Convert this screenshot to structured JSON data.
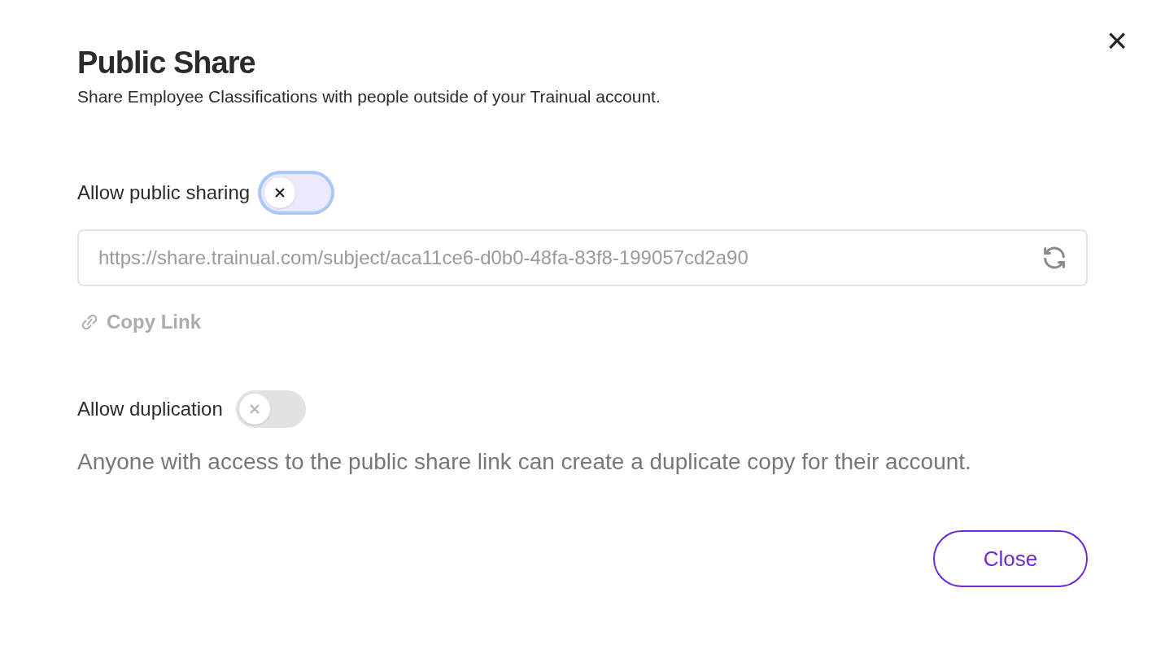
{
  "dialog": {
    "title": "Public Share",
    "subtitle": "Share Employee Classifications with people outside of your Trainual account.",
    "close_icon": "×"
  },
  "public_sharing": {
    "label": "Allow public sharing",
    "on": false,
    "focused": true
  },
  "link_field": {
    "value": "https://share.trainual.com/subject/aca11ce6-d0b0-48fa-83f8-199057cd2a90"
  },
  "copy_link": {
    "label": "Copy Link",
    "disabled": true
  },
  "duplication": {
    "label": "Allow duplication",
    "on": false,
    "focused": false,
    "disabled": true,
    "description": "Anyone with access to the public share link can create a duplicate copy for their account."
  },
  "buttons": [
    {
      "label": "Close"
    }
  ]
}
